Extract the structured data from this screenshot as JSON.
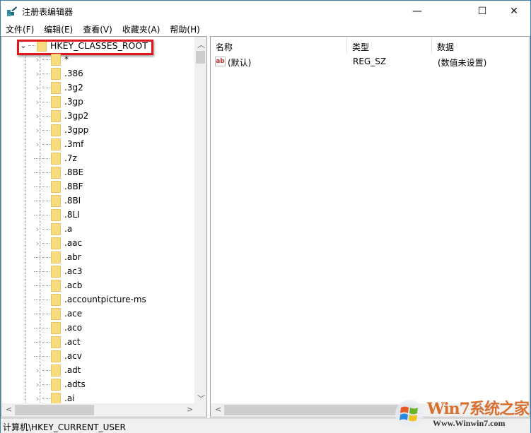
{
  "window": {
    "title": "注册表编辑器",
    "minimize": "—",
    "maximize": "☐",
    "close": "✕"
  },
  "menu": [
    "文件(F)",
    "编辑(E)",
    "查看(V)",
    "收藏夹(A)",
    "帮助(H)"
  ],
  "tree": {
    "root": "HKEY_CLASSES_ROOT",
    "items": [
      {
        "label": "*",
        "expandable": true
      },
      {
        "label": ".386",
        "expandable": true
      },
      {
        "label": ".3g2",
        "expandable": true
      },
      {
        "label": ".3gp",
        "expandable": true
      },
      {
        "label": ".3gp2",
        "expandable": true
      },
      {
        "label": ".3gpp",
        "expandable": true
      },
      {
        "label": ".3mf",
        "expandable": true
      },
      {
        "label": ".7z",
        "expandable": false
      },
      {
        "label": ".8BE",
        "expandable": false
      },
      {
        "label": ".8BF",
        "expandable": false
      },
      {
        "label": ".8BI",
        "expandable": false
      },
      {
        "label": ".8LI",
        "expandable": false
      },
      {
        "label": ".a",
        "expandable": true
      },
      {
        "label": ".aac",
        "expandable": true
      },
      {
        "label": ".abr",
        "expandable": false
      },
      {
        "label": ".ac3",
        "expandable": false
      },
      {
        "label": ".acb",
        "expandable": false
      },
      {
        "label": ".accountpicture-ms",
        "expandable": false
      },
      {
        "label": ".ace",
        "expandable": false
      },
      {
        "label": ".aco",
        "expandable": false
      },
      {
        "label": ".act",
        "expandable": false
      },
      {
        "label": ".acv",
        "expandable": false
      },
      {
        "label": ".adt",
        "expandable": true
      },
      {
        "label": ".adts",
        "expandable": true
      },
      {
        "label": ".ai",
        "expandable": true
      }
    ]
  },
  "list": {
    "columns": [
      "名称",
      "类型",
      "数据"
    ],
    "rows": [
      {
        "name": "(默认)",
        "type": "REG_SZ",
        "data": "(数值未设置)",
        "icon": "ab"
      }
    ]
  },
  "status": "计算机\\HKEY_CURRENT_USER",
  "watermark": {
    "brand": "Win7系统之家",
    "url": "Www.Winwin7.com"
  }
}
